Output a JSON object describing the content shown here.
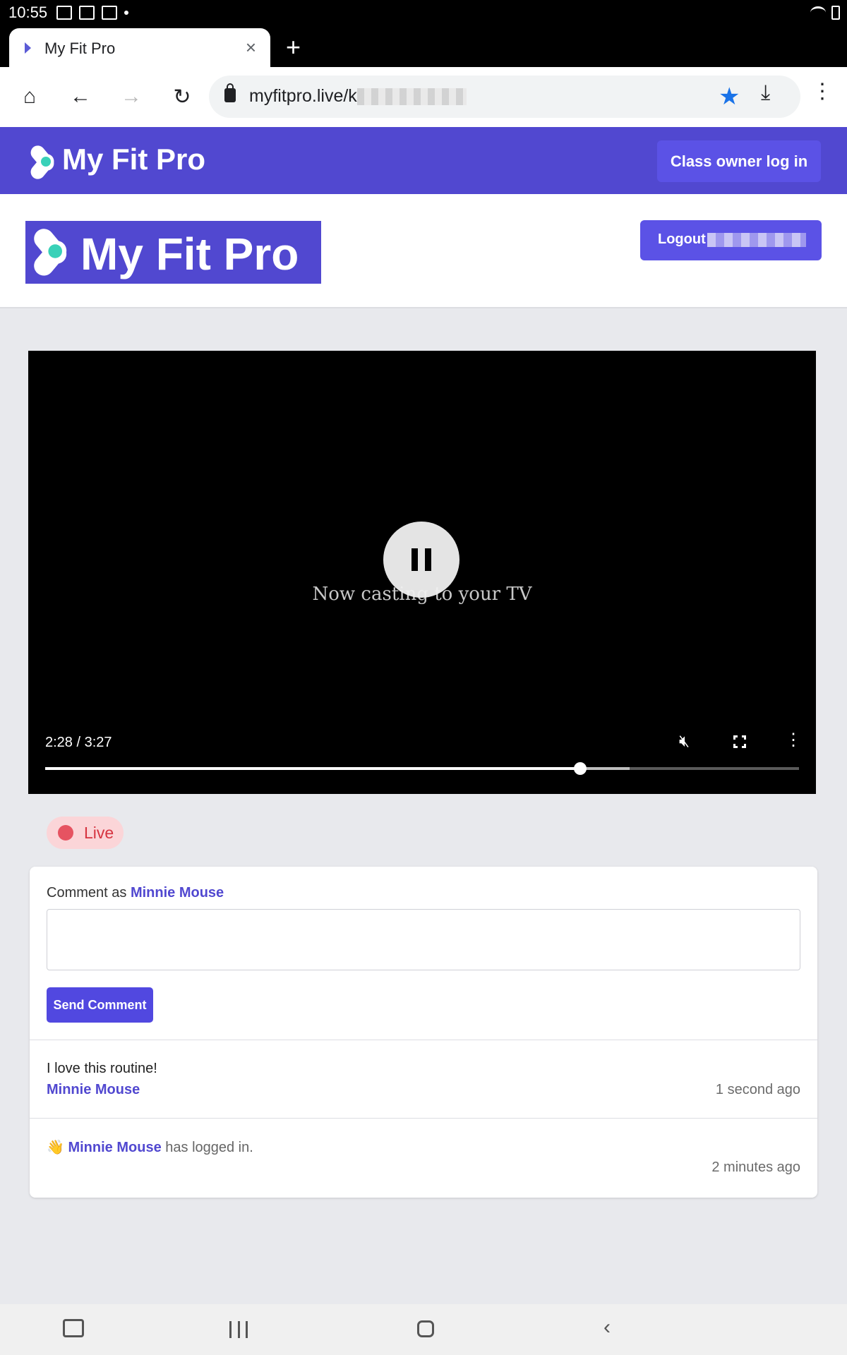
{
  "status_bar": {
    "time": "10:55"
  },
  "browser": {
    "tab_title": "My Fit Pro",
    "tab_close": "×",
    "new_tab": "+",
    "url": "myfitpro.live/k",
    "icons": {
      "home": "home-icon",
      "back": "back-arrow-icon",
      "forward": "forward-arrow-icon",
      "reload": "reload-icon",
      "lock": "lock-icon",
      "bookmark": "star-icon",
      "download": "download-icon",
      "menu": "more-vert-icon"
    },
    "star_color": "#1a73e8"
  },
  "site_header": {
    "brand": "My Fit Pro",
    "owner_login": "Class owner log in",
    "header_color": "#5148d0",
    "button_color": "#5b52e6"
  },
  "logo_band": {
    "brand": "My Fit Pro",
    "logout_label": "Logout"
  },
  "video": {
    "cast_message": "Now casting to your TV",
    "time": "2:28 / 3:27",
    "progress": 0.71,
    "buffered": 0.775,
    "state": "playing"
  },
  "live_badge": {
    "label": "Live",
    "color": "#e65361"
  },
  "comments": {
    "comment_as_prefix": "Comment as ",
    "user_name": "Minnie Mouse",
    "input_value": "",
    "send_label": "Send Comment",
    "items": [
      {
        "text": "I love this routine!",
        "author": "Minnie Mouse",
        "time": "1 second ago"
      },
      {
        "icon": "waving-hand-icon",
        "author": "Minnie Mouse",
        "text": " has logged in.",
        "time": "2 minutes ago"
      }
    ]
  },
  "nav_bar": {
    "icons": [
      "keyboard-icon",
      "recents-icon",
      "home-icon",
      "back-icon"
    ]
  }
}
